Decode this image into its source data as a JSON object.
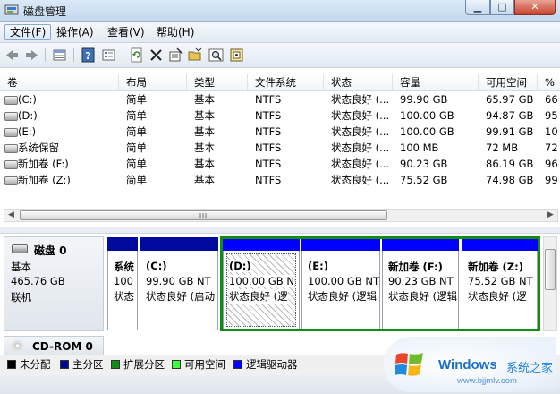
{
  "window": {
    "title": "磁盘管理"
  },
  "menu": [
    "文件(F)",
    "操作(A)",
    "查看(V)",
    "帮助(H)"
  ],
  "toolbar": [
    "back-icon",
    "forward-icon",
    "disk-list-icon",
    "help-icon",
    "properties-icon",
    "refresh-icon",
    "delete-icon",
    "new-volume-icon",
    "open-folder-icon",
    "search-icon",
    "format-icon"
  ],
  "volume_table": {
    "columns": [
      "卷",
      "布局",
      "类型",
      "文件系统",
      "状态",
      "容量",
      "可用空间",
      "%"
    ],
    "rows": [
      [
        "(C:)",
        "简单",
        "基本",
        "NTFS",
        "状态良好 (...",
        "99.90 GB",
        "65.97 GB",
        "66"
      ],
      [
        "(D:)",
        "简单",
        "基本",
        "NTFS",
        "状态良好 (...",
        "100.00 GB",
        "94.87 GB",
        "95"
      ],
      [
        "(E:)",
        "简单",
        "基本",
        "NTFS",
        "状态良好 (...",
        "100.00 GB",
        "99.91 GB",
        "10"
      ],
      [
        "系统保留",
        "简单",
        "基本",
        "NTFS",
        "状态良好 (...",
        "100 MB",
        "72 MB",
        "72"
      ],
      [
        "新加卷 (F:)",
        "简单",
        "基本",
        "NTFS",
        "状态良好 (...",
        "90.23 GB",
        "86.19 GB",
        "96"
      ],
      [
        "新加卷 (Z:)",
        "简单",
        "基本",
        "NTFS",
        "状态良好 (...",
        "75.52 GB",
        "74.98 GB",
        "99"
      ]
    ]
  },
  "disk0": {
    "name": "磁盘 0",
    "type": "基本",
    "size": "465.76 GB",
    "state": "联机",
    "partitions": [
      {
        "name": "系统",
        "size": "100",
        "status": "状态",
        "bar_color": "#000a9e",
        "selected": false
      },
      {
        "name": "(C:)",
        "size": "99.90 GB NT",
        "status": "状态良好 (启动",
        "bar_color": "#000a9e",
        "selected": false
      },
      {
        "name": "(D:)",
        "size": "100.00 GB N",
        "status": "状态良好 (逻",
        "bar_color": "#0000ff",
        "selected": true
      },
      {
        "name": "(E:)",
        "size": "100.00 GB NT",
        "status": "状态良好 (逻辑",
        "bar_color": "#0000ff",
        "selected": false
      },
      {
        "name": "新加卷 (F:)",
        "size": "90.23 GB NT",
        "status": "状态良好 (逻辑",
        "bar_color": "#0000ff",
        "selected": false
      },
      {
        "name": "新加卷 (Z:)",
        "size": "75.52 GB NT",
        "status": "状态良好 (逻",
        "bar_color": "#0000ff",
        "selected": false
      }
    ]
  },
  "cdrom": {
    "name": "CD-ROM 0"
  },
  "legend": [
    {
      "label": "未分配",
      "color": "#000000"
    },
    {
      "label": "主分区",
      "color": "#000a8a"
    },
    {
      "label": "扩展分区",
      "color": "#118d11"
    },
    {
      "label": "可用空间",
      "color": "#40ff40"
    },
    {
      "label": "逻辑驱动器",
      "color": "#0000ff"
    }
  ],
  "watermark": {
    "brand": "Windows",
    "site": "系统之家",
    "url": "www.bjjmlv.com"
  }
}
